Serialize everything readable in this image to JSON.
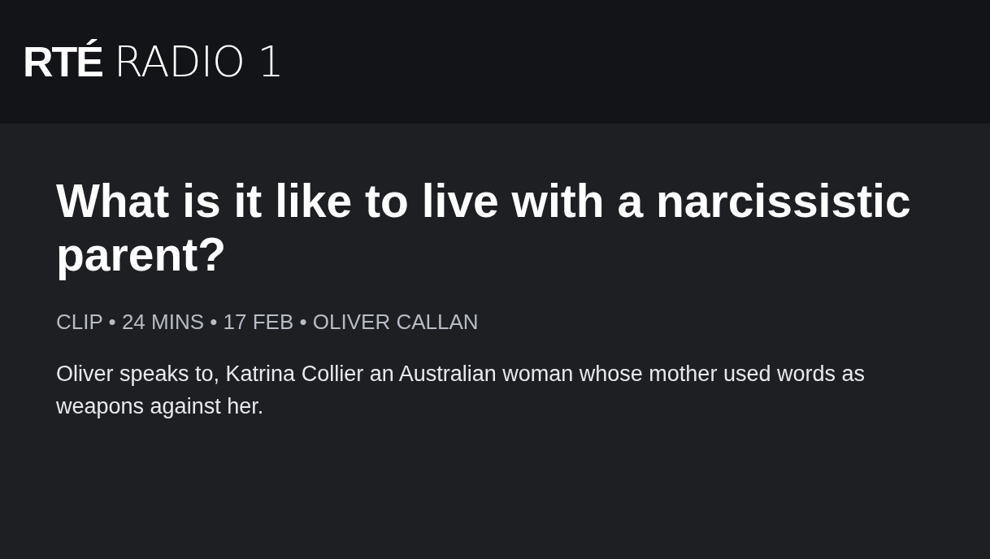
{
  "header": {
    "logo": {
      "brand": "RTÉ",
      "station": "RADIO 1"
    }
  },
  "clip": {
    "title": "What is it like to live with a narcissistic parent?",
    "meta": "CLIP • 24 MINS • 17 FEB • OLIVER CALLAN",
    "description": "Oliver speaks to, Katrina Collier an Australian woman whose mother used words as weapons against her."
  }
}
